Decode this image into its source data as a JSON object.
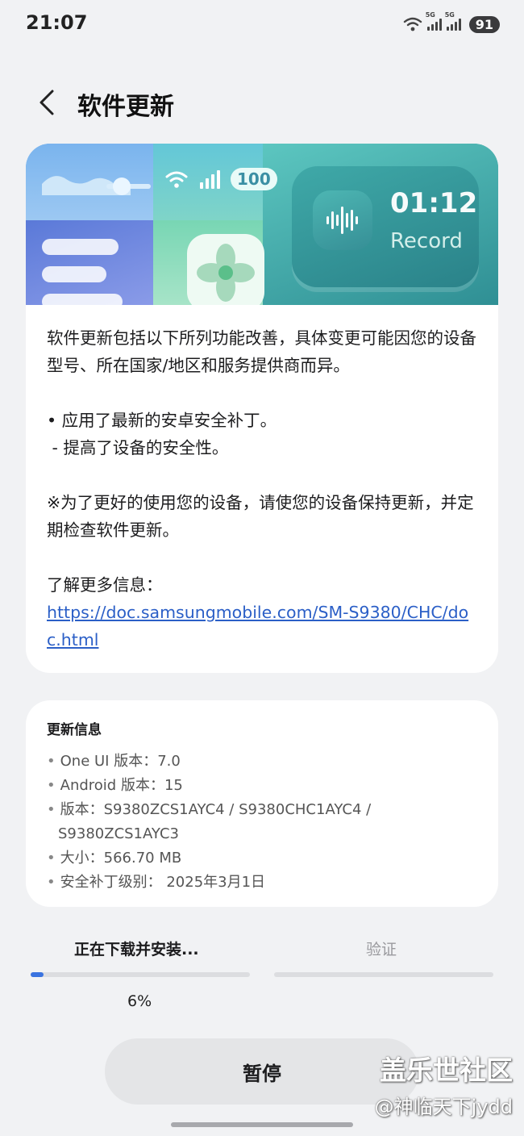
{
  "status_bar": {
    "time": "21:07",
    "battery": "91",
    "signal_labels": [
      "5G",
      "5G"
    ]
  },
  "header": {
    "title": "软件更新"
  },
  "banner": {
    "battery_pill": "100",
    "record_time": "01:12",
    "record_label": "Record"
  },
  "description": {
    "intro": "软件更新包括以下所列功能改善，具体变更可能因您的设备型号、所在国家/地区和服务提供商而异。",
    "bullet": "• 应用了最新的安卓安全补丁。",
    "sub_bullet": " - 提高了设备的安全性。",
    "note": "※为了更好的使用您的设备，请使您的设备保持更新，并定期检查软件更新。",
    "more_info_label": "了解更多信息：",
    "more_info_link": "https://doc.samsungmobile.com/SM-S9380/CHC/doc.html"
  },
  "update_info": {
    "title": "更新信息",
    "one_ui": "One UI 版本：7.0",
    "android": "Android 版本：15",
    "version_line1": "版本：S9380ZCS1AYC4 / S9380CHC1AYC4 /",
    "version_line2": "S9380ZCS1AYC3",
    "size": "大小：566.70 MB",
    "patch": "安全补丁级别： 2025年3月1日"
  },
  "progress": {
    "step_active": "正在下载并安装...",
    "step_next": "验证",
    "percent_text": "6%",
    "fraction": 0.06,
    "accent": "#3a73e0"
  },
  "pause_button": "暂停",
  "watermark": {
    "line1": "盖乐世社区",
    "line2": "@神临天下jydd"
  }
}
